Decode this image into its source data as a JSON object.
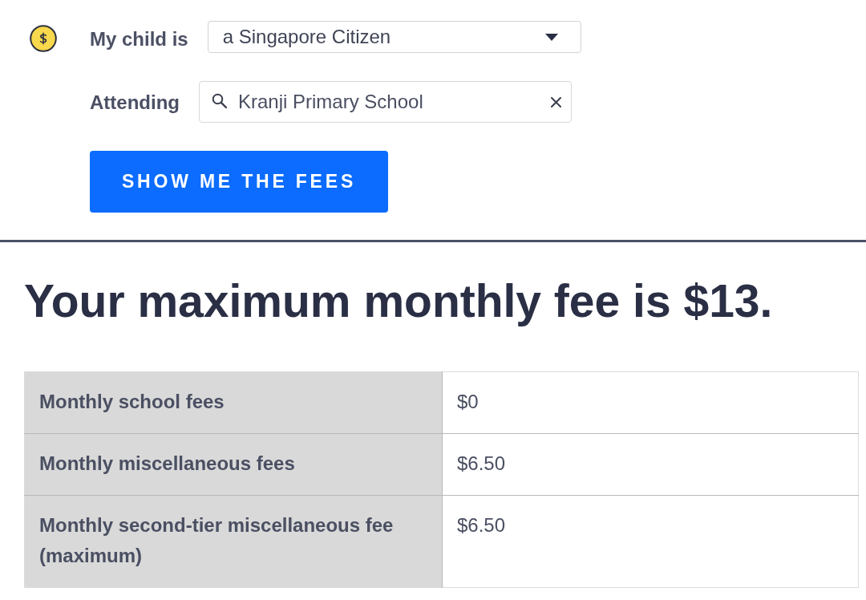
{
  "form": {
    "fields": [
      {
        "kind": "select",
        "label": "My child is",
        "value": "a Singapore Citizen"
      },
      {
        "kind": "search",
        "label": "Attending",
        "value": "Kranji Primary School"
      }
    ],
    "submit_button": "SHOW ME THE FEES"
  },
  "result": {
    "heading": "Your maximum monthly fee is $13.",
    "table": {
      "rows": [
        {
          "label": "Monthly school fees",
          "value": "$0"
        },
        {
          "label": "Monthly miscellaneous fees",
          "value": "$6.50"
        },
        {
          "label": "Monthly second-tier miscellaneous fee (maximum)",
          "value": "$6.50"
        }
      ]
    }
  }
}
